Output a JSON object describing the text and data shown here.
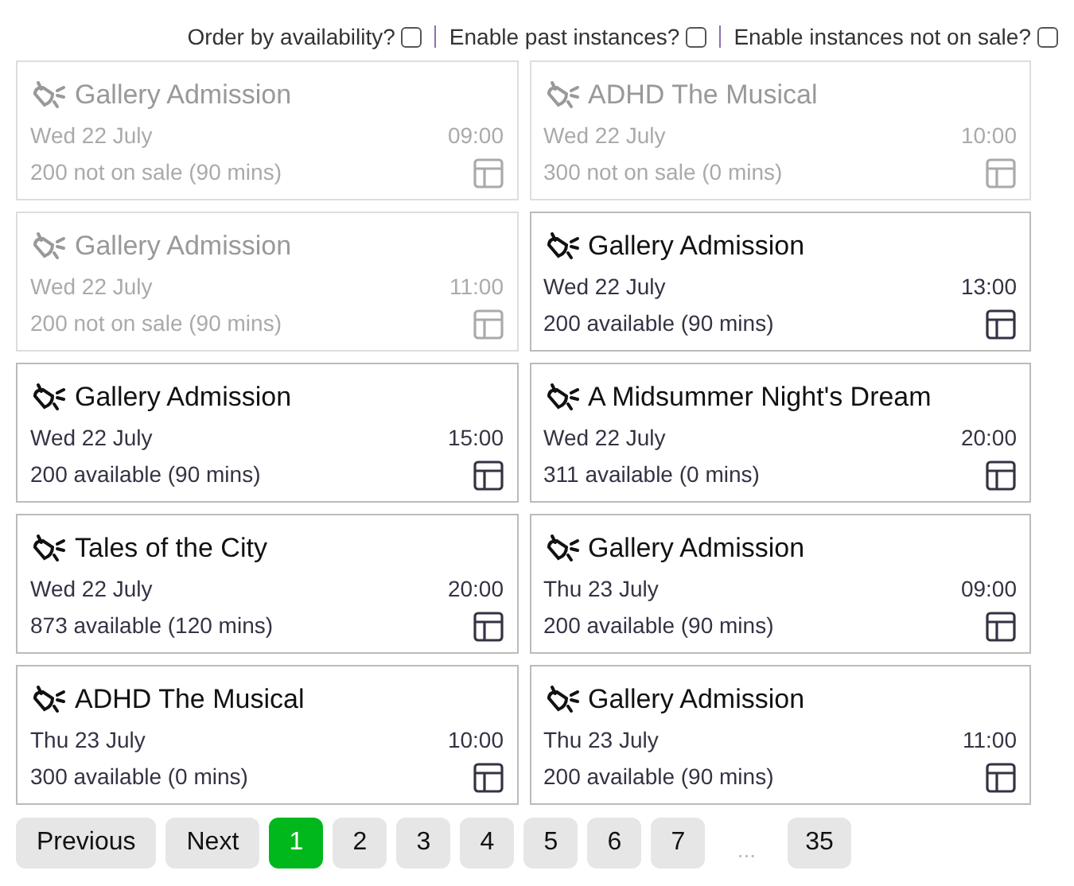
{
  "filters": [
    {
      "label": "Order by availability?",
      "checked": false
    },
    {
      "label": "Enable past instances?",
      "checked": false
    },
    {
      "label": "Enable instances not on sale?",
      "checked": false
    }
  ],
  "events": [
    {
      "title": "Gallery Admission",
      "date": "Wed 22 July",
      "time": "09:00",
      "availability": "200 not on sale (90 mins)",
      "disabled": true
    },
    {
      "title": "ADHD The Musical",
      "date": "Wed 22 July",
      "time": "10:00",
      "availability": "300 not on sale (0 mins)",
      "disabled": true
    },
    {
      "title": "Gallery Admission",
      "date": "Wed 22 July",
      "time": "11:00",
      "availability": "200 not on sale (90 mins)",
      "disabled": true
    },
    {
      "title": "Gallery Admission",
      "date": "Wed 22 July",
      "time": "13:00",
      "availability": "200 available (90 mins)",
      "disabled": false
    },
    {
      "title": "Gallery Admission",
      "date": "Wed 22 July",
      "time": "15:00",
      "availability": "200 available (90 mins)",
      "disabled": false
    },
    {
      "title": "A Midsummer Night's Dream",
      "date": "Wed 22 July",
      "time": "20:00",
      "availability": "311 available (0 mins)",
      "disabled": false
    },
    {
      "title": "Tales of the City",
      "date": "Wed 22 July",
      "time": "20:00",
      "availability": "873 available (120 mins)",
      "disabled": false
    },
    {
      "title": "Gallery Admission",
      "date": "Thu 23 July",
      "time": "09:00",
      "availability": "200 available (90 mins)",
      "disabled": false
    },
    {
      "title": "ADHD The Musical",
      "date": "Thu 23 July",
      "time": "10:00",
      "availability": "300 available (0 mins)",
      "disabled": false
    },
    {
      "title": "Gallery Admission",
      "date": "Thu 23 July",
      "time": "11:00",
      "availability": "200 available (90 mins)",
      "disabled": false
    }
  ],
  "pagination": {
    "previous": "Previous",
    "next": "Next",
    "pages": [
      {
        "kind": "page",
        "label": "1",
        "selected": true
      },
      {
        "kind": "page",
        "label": "2",
        "selected": false
      },
      {
        "kind": "page",
        "label": "3",
        "selected": false
      },
      {
        "kind": "page",
        "label": "4",
        "selected": false
      },
      {
        "kind": "page",
        "label": "5",
        "selected": false
      },
      {
        "kind": "page",
        "label": "6",
        "selected": false
      },
      {
        "kind": "page",
        "label": "7",
        "selected": false
      },
      {
        "kind": "ellipsis",
        "label": "..."
      },
      {
        "kind": "page",
        "label": "35",
        "selected": false
      }
    ]
  }
}
